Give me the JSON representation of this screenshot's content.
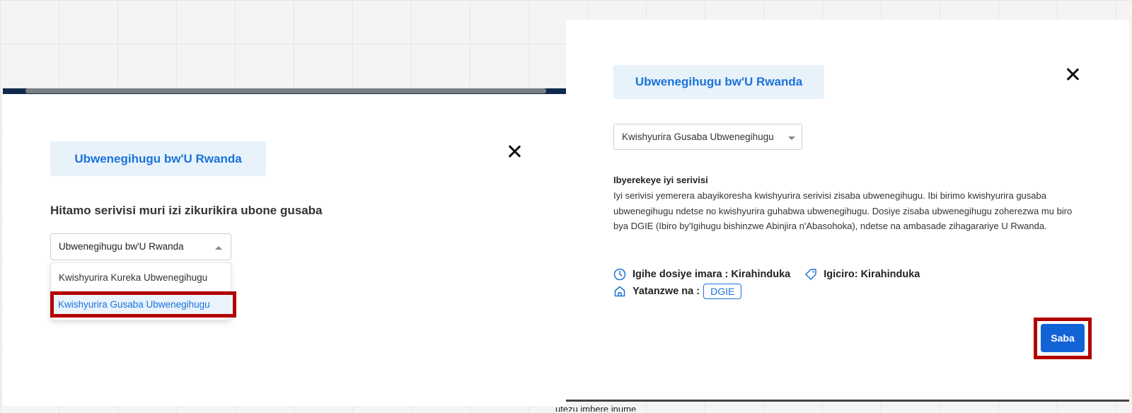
{
  "left_dialog": {
    "title": "Ubwenegihugu bw'U Rwanda",
    "prompt": "Hitamo serivisi muri izi zikurikira ubone gusaba",
    "select_value": "Ubwenegihugu bw'U Rwanda",
    "options": [
      "Kwishyurira Kureka Ubwenegihugu",
      "Kwishyurira Gusaba Ubwenegihugu"
    ]
  },
  "right_dialog": {
    "title": "Ubwenegihugu bw'U Rwanda",
    "service_select_value": "Kwishyurira Gusaba Ubwenegihugu",
    "description_title": "Ibyerekeye iyi serivisi",
    "description_body": "Iyi serivisi yemerera abayikoresha kwishyurira serivisi zisaba ubwenegihugu. Ibi birimo kwishyurira gusaba ubwenegihugu ndetse no kwishyurira guhabwa ubwenegihugu. Dosiye zisaba ubwenegihugu zoherezwa mu biro bya DGIE (Ibiro by'Igihugu bishinzwe Abinjira n'Abasohoka), ndetse na ambasade zihagarariye U Rwanda.",
    "duration_label": "Igihe dosiye imara : Kirahinduka",
    "price_label": "Igiciro: Kirahinduka",
    "provider_label": "Yatanzwe na :",
    "provider_badge": "DGIE",
    "submit_label": "Saba"
  },
  "background_text": "utezu imbere inume",
  "colors": {
    "accent": "#1a73d9",
    "highlight_border": "#b30000",
    "chip_bg": "#e8f2fb",
    "button_bg": "#1264d6"
  }
}
